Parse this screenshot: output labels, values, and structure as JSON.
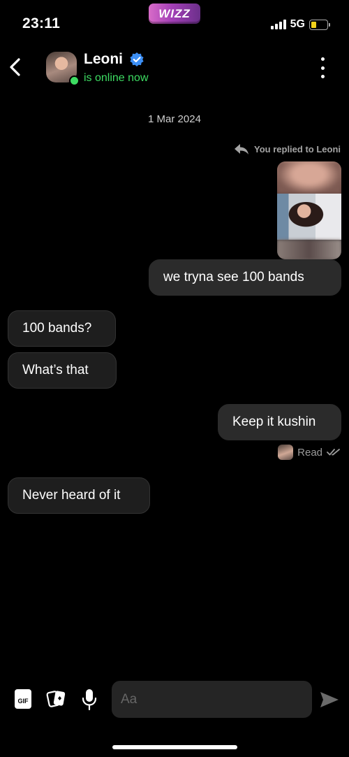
{
  "status_bar": {
    "time": "23:11",
    "brand": "WIZZ",
    "network": "5G",
    "battery_level": 0.35
  },
  "header": {
    "name": "Leoni",
    "status": "is online now",
    "verified": true
  },
  "conversation": {
    "date": "1 Mar 2024",
    "reply_note": "You replied to Leoni",
    "messages": [
      {
        "side": "out",
        "text": "we tryna see 100 bands"
      },
      {
        "side": "in",
        "text": "100 bands?"
      },
      {
        "side": "in",
        "text": "What’s that"
      },
      {
        "side": "out",
        "text": "Keep it kushin"
      },
      {
        "side": "in",
        "text": "Never heard of it"
      }
    ],
    "read_receipt": "Read"
  },
  "composer": {
    "gif_label": "GIF",
    "placeholder": "Aa"
  },
  "colors": {
    "online_green": "#3ddc62",
    "verified_blue": "#3c8ff5",
    "bubble_out": "#2b2b2b",
    "bubble_in": "#1e1e1e"
  }
}
